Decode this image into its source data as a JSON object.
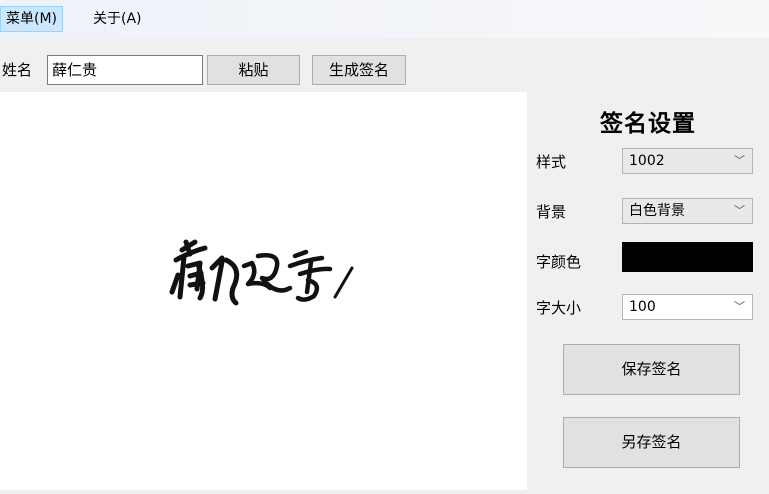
{
  "menubar": {
    "menu": "菜单(M)",
    "about": "关于(A)"
  },
  "toolbar": {
    "name_label": "姓名",
    "name_value": "薛仁贵",
    "paste_label": "粘贴",
    "generate_label": "生成签名"
  },
  "settings": {
    "title": "签名设置",
    "style_label": "样式",
    "style_value": "1002",
    "background_label": "背景",
    "background_value": "白色背景",
    "font_color_label": "字颜色",
    "font_color": "#000000",
    "font_size_label": "字大小",
    "font_size_value": "100",
    "save_label": "保存签名",
    "save_as_label": "另存签名"
  },
  "colors": {
    "menu_highlight": "#cce8ff",
    "canvas_bg": "#ffffff",
    "panel_bg": "#f0f0f0"
  }
}
